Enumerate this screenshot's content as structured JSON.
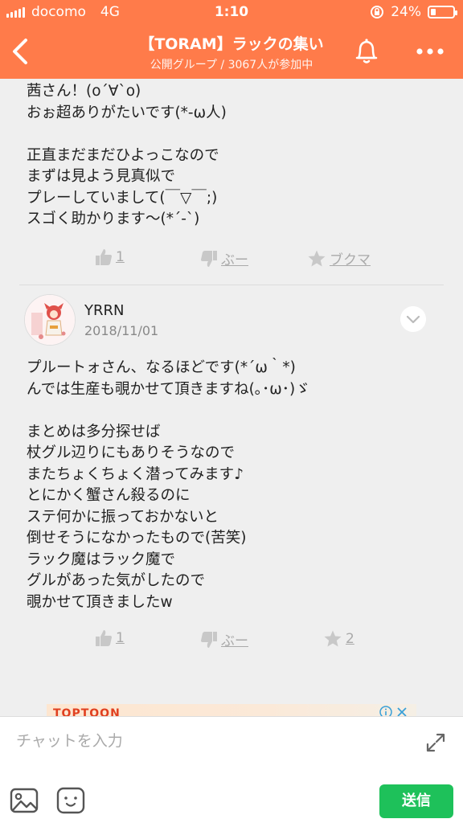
{
  "status": {
    "carrier": "docomo",
    "network": "4G",
    "time": "1:10",
    "battery": "24%",
    "battery_level": 0.24
  },
  "header": {
    "title": "【TORAM】ラックの集い",
    "subtitle": "公開グループ / 3067人が参加中"
  },
  "messages": [
    {
      "text": "茜さん！(o´∀`o)\nおぉ超ありがたいです(*-ω人)\n\n正直まだまだひよっこなので\nまずは見よう見真似で\nプレーしていまして(￣▽￣;)\nスゴく助かります〜(*´-`)",
      "like_count": "1",
      "boo_label": "ぶー",
      "bookmark_label": "ブクマ"
    },
    {
      "username": "YRRN",
      "date": "2018/11/01",
      "text": "プルートォさん、なるほどです(*´ω｀*)\nんでは生産も覗かせて頂きますね(｡･ω･)ゞ\n\nまとめは多分探せば\n杖グル辺りにもありそうなので\nまたちょくちょく潜ってみます♪\nとにかく蟹さん殺るのに\nステ何かに振っておかないと\n倒せそうになかったもので(苦笑)\nラック魔はラック魔で\nグルがあった気がしたので\n覗かせて頂きましたw",
      "like_count": "1",
      "boo_label": "ぶー",
      "bookmark_label": "2"
    }
  ],
  "ad": {
    "logo": "TOPTOON"
  },
  "input": {
    "placeholder": "チャットを入力",
    "send_label": "送信"
  },
  "colors": {
    "header": "#ff7b4a",
    "send": "#1ec15a"
  }
}
